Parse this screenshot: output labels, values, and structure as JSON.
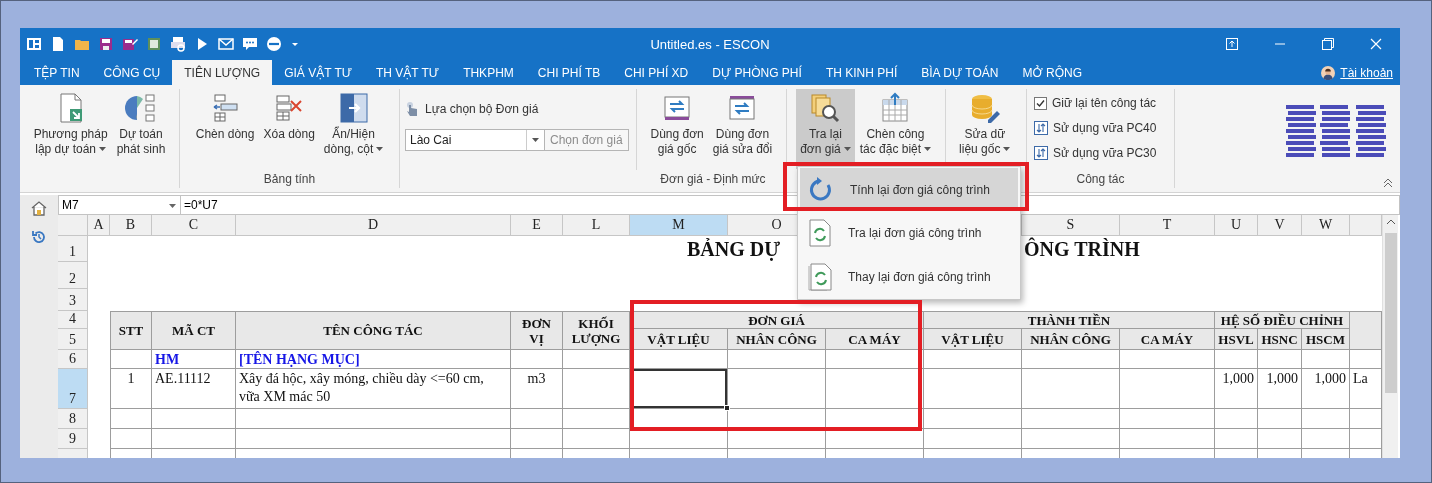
{
  "title_bar": {
    "title": "Untitled.es - ESCON"
  },
  "tabs": [
    {
      "label": "TỆP TIN",
      "selected": false
    },
    {
      "label": "CÔNG CỤ",
      "selected": false
    },
    {
      "label": "TIÊN LƯỢNG",
      "selected": true
    },
    {
      "label": "GIÁ VẬT TƯ",
      "selected": false
    },
    {
      "label": "TH VẬT TƯ",
      "selected": false
    },
    {
      "label": "THKPHM",
      "selected": false
    },
    {
      "label": "CHI PHÍ TB",
      "selected": false
    },
    {
      "label": "CHI PHÍ XD",
      "selected": false
    },
    {
      "label": "DỰ PHÒNG PHÍ",
      "selected": false
    },
    {
      "label": "TH KINH PHÍ",
      "selected": false
    },
    {
      "label": "BÌA DỰ TOÁN",
      "selected": false
    },
    {
      "label": "MỞ RỘNG",
      "selected": false
    }
  ],
  "account": {
    "label": "Tài khoản"
  },
  "ribbon": {
    "groups": [
      {
        "sections": [
          {
            "kind": "buttons",
            "buttons": [
              {
                "lines": [
                  "Phương pháp",
                  "lập dự toán"
                ],
                "dropdown": true,
                "pressed": false
              },
              {
                "lines": [
                  "Dự toán",
                  "phát sinh"
                ],
                "dropdown": false,
                "pressed": false
              }
            ]
          }
        ]
      },
      {
        "label": "Bảng tính",
        "sections": [
          {
            "kind": "buttons",
            "buttons": [
              {
                "lines": [
                  "Chèn dòng"
                ],
                "dropdown": false,
                "pressed": false
              },
              {
                "lines": [
                  "Xóa dòng"
                ],
                "dropdown": false,
                "pressed": false
              },
              {
                "lines": [
                  "Ẩn/Hiện",
                  "dòng, cột"
                ],
                "dropdown": true,
                "pressed": false
              }
            ]
          }
        ]
      },
      {
        "label": "Đơn giá - Định mức",
        "sections": [
          {
            "kind": "selector",
            "label": "Lựa chọn bộ Đơn giá",
            "value": "Lào Cai",
            "action": "Chọn đơn giá",
            "action_disabled": true
          },
          {
            "kind": "buttons",
            "buttons": [
              {
                "lines": [
                  "Dùng đơn",
                  "giá gốc"
                ],
                "dropdown": false,
                "pressed": false
              },
              {
                "lines": [
                  "Dùng đơn",
                  "giá sửa đổi"
                ],
                "dropdown": false,
                "pressed": false
              }
            ]
          },
          {
            "kind": "buttons",
            "buttons": [
              {
                "lines": [
                  "Tra lại",
                  "đơn giá"
                ],
                "dropdown": true,
                "pressed": true
              },
              {
                "lines": [
                  "Chèn công",
                  "tác đặc biệt"
                ],
                "dropdown": true,
                "pressed": false
              }
            ]
          },
          {
            "kind": "buttons",
            "buttons": [
              {
                "lines": [
                  "Sửa dữ",
                  "liệu gốc"
                ],
                "dropdown": true,
                "pressed": false
              }
            ]
          }
        ]
      },
      {
        "label": "Công tác",
        "sections": [
          {
            "kind": "options",
            "items": [
              {
                "kind": "checkbox",
                "label": "Giữ lại tên công tác",
                "checked": true
              },
              {
                "kind": "button",
                "label": "Sử dụng vữa PC40"
              },
              {
                "kind": "button",
                "label": "Sử dụng vữa PC30"
              }
            ]
          }
        ]
      }
    ]
  },
  "menu": {
    "items": [
      {
        "label": "Tính lại đơn giá công trình",
        "selected": true
      },
      {
        "label": "Tra lại đơn giá công trình",
        "selected": false
      },
      {
        "label": "Thay lại đơn giá công trình",
        "selected": false
      }
    ]
  },
  "formula_bar": {
    "name_box": "M7",
    "formula": "=0*U7"
  },
  "sheet": {
    "columns": [
      {
        "label": "A",
        "selected": false
      },
      {
        "label": "B",
        "selected": false
      },
      {
        "label": "C",
        "selected": false
      },
      {
        "label": "D",
        "selected": false
      },
      {
        "label": "E",
        "selected": false
      },
      {
        "label": "L",
        "selected": false
      },
      {
        "label": "M",
        "selected": true
      },
      {
        "label": "O",
        "selected": false
      },
      {
        "label": "S",
        "selected": false
      },
      {
        "label": "T",
        "selected": false
      },
      {
        "label": "U",
        "selected": false
      },
      {
        "label": "V",
        "selected": false
      },
      {
        "label": "W",
        "selected": false
      }
    ],
    "rows": [
      {
        "label": "1",
        "selected": false
      },
      {
        "label": "2",
        "selected": false
      },
      {
        "label": "3",
        "selected": false
      },
      {
        "label": "4",
        "selected": false
      },
      {
        "label": "5",
        "selected": false
      },
      {
        "label": "6",
        "selected": false
      },
      {
        "label": "7",
        "selected": true
      },
      {
        "label": "8",
        "selected": false
      },
      {
        "label": "9",
        "selected": false
      }
    ],
    "title_parts": [
      "BẢNG DỰ",
      "ÔNG TRÌNH"
    ],
    "header": [
      {
        "label": "STT"
      },
      {
        "label": "MÃ CT"
      },
      {
        "label": "TÊN CÔNG TÁC"
      },
      {
        "label": "ĐƠN VỊ"
      },
      {
        "label": "KHỐI LƯỢNG"
      },
      {
        "label": "ĐƠN GIÁ",
        "columns": [
          "VẬT LIỆU",
          "NHÂN CÔNG",
          "CA MÁY"
        ]
      },
      {
        "label": "THÀNH TIỀN",
        "columns": [
          "VẬT LIỆU",
          "NHÂN CÔNG",
          "CA MÁY"
        ]
      },
      {
        "label": "HỆ SỐ ĐIỀU CHỈNH",
        "columns": [
          "HSVL",
          "HSNC",
          "HSCM"
        ]
      }
    ],
    "body": [
      {
        "kind": "category",
        "code": "HM",
        "name": "[TÊN HẠNG MỤC]"
      },
      {
        "kind": "item",
        "stt": "1",
        "code": "AE.11112",
        "name": "Xây đá hộc, xây móng, chiều dày <=60 cm, vữa XM mác 50",
        "unit": "m3",
        "factors": [
          "1,000",
          "1,000",
          "1,000"
        ],
        "note": "La"
      }
    ]
  }
}
